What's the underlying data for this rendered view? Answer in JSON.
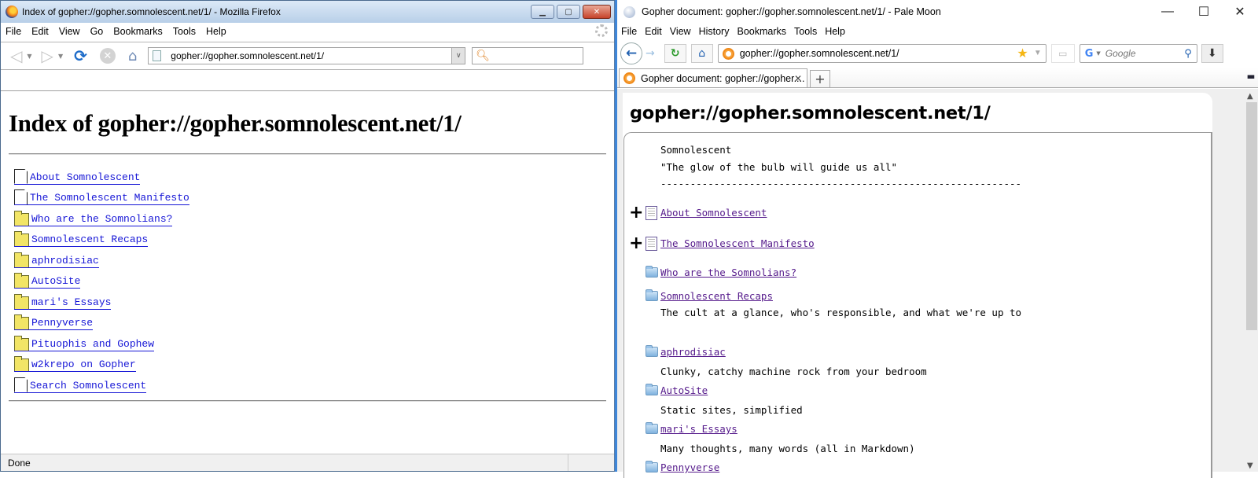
{
  "firefox": {
    "window_title": "Index of gopher://gopher.somnolescent.net/1/ - Mozilla Firefox",
    "window_controls": {
      "minimize": "▁",
      "maximize": "▢",
      "close": "✕"
    },
    "menu": [
      "File",
      "Edit",
      "View",
      "Go",
      "Bookmarks",
      "Tools",
      "Help"
    ],
    "url": "gopher://gopher.somnolescent.net/1/",
    "search_value": "",
    "page": {
      "heading": "Index of gopher://gopher.somnolescent.net/1/",
      "items": [
        {
          "type": "file",
          "label": "About Somnolescent"
        },
        {
          "type": "file",
          "label": "The Somnolescent Manifesto"
        },
        {
          "type": "folder",
          "label": "Who are the Somnolians?"
        },
        {
          "type": "folder",
          "label": "Somnolescent Recaps"
        },
        {
          "type": "folder",
          "label": "aphrodisiac"
        },
        {
          "type": "folder",
          "label": "AutoSite"
        },
        {
          "type": "folder",
          "label": "mari's Essays"
        },
        {
          "type": "folder",
          "label": "Pennyverse"
        },
        {
          "type": "folder",
          "label": "Pituophis and Gophew"
        },
        {
          "type": "folder",
          "label": "w2krepo on Gopher"
        },
        {
          "type": "file",
          "label": "Search Somnolescent"
        }
      ]
    },
    "status": "Done"
  },
  "palemoon": {
    "window_title": "Gopher document: gopher://gopher.somnolescent.net/1/ - Pale Moon",
    "window_controls": {
      "minimize": "—",
      "maximize": "☐",
      "close": "✕"
    },
    "menu": [
      "File",
      "Edit",
      "View",
      "History",
      "Bookmarks",
      "Tools",
      "Help"
    ],
    "url": "gopher://gopher.somnolescent.net/1/",
    "search_engine": "G",
    "search_placeholder": "Google",
    "tab_title": "Gopher document: gopher://gopher....",
    "tab_close": "✕",
    "new_tab": "+",
    "page": {
      "heading": "gopher://gopher.somnolescent.net/1/",
      "info_lines": [
        "Somnolescent",
        "\"The glow of the bulb will guide us all\"",
        "-------------------------------------------------------------"
      ],
      "entries": [
        {
          "type": "doc",
          "label": "About Somnolescent",
          "expand": "+",
          "desc": ""
        },
        {
          "type": "doc",
          "label": "The Somnolescent Manifesto",
          "expand": "+",
          "desc": ""
        },
        {
          "type": "dir",
          "label": "Who are the Somnolians?",
          "desc": ""
        },
        {
          "type": "dir",
          "label": "Somnolescent Recaps",
          "desc": "The cult at a glance, who's responsible, and what we're up to"
        },
        {
          "type": "dir",
          "label": "aphrodisiac",
          "desc": "Clunky, catchy machine rock from your bedroom"
        },
        {
          "type": "dir",
          "label": "AutoSite",
          "desc": "Static sites, simplified"
        },
        {
          "type": "dir",
          "label": "mari's Essays",
          "desc": "Many thoughts, many words (all in Markdown)"
        },
        {
          "type": "dir",
          "label": "Pennyverse",
          "desc": ""
        }
      ]
    }
  }
}
